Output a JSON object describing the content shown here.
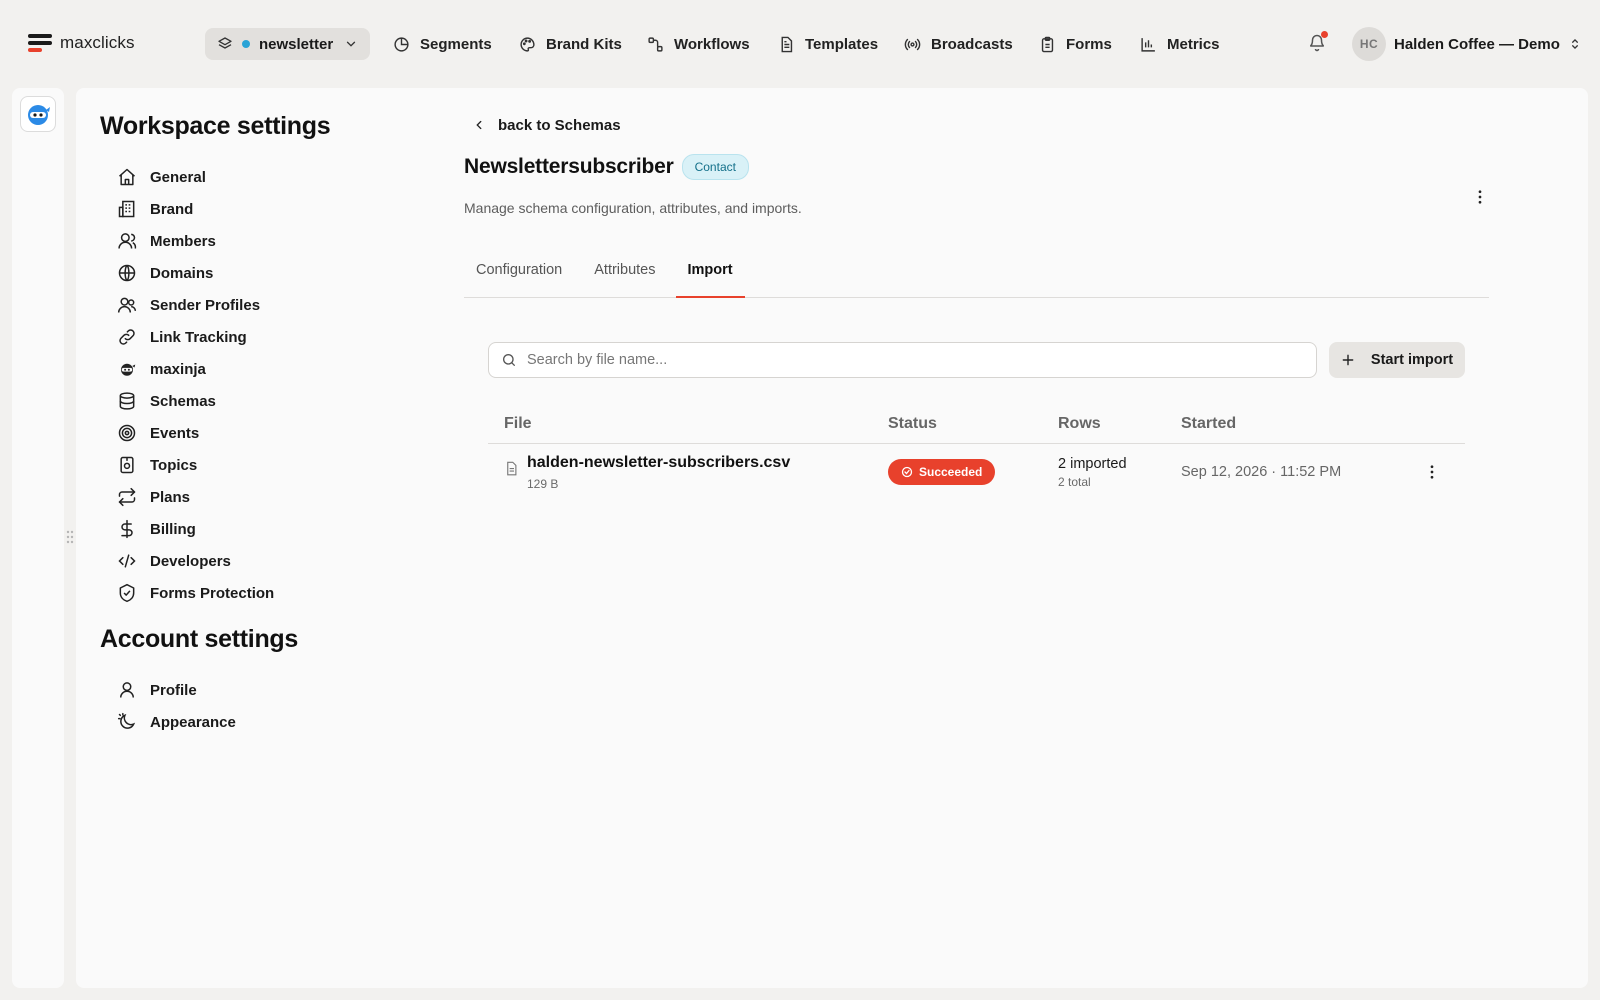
{
  "brand": {
    "name": "maxclicks"
  },
  "workspace": {
    "name": "newsletter"
  },
  "nav": [
    {
      "label": "Segments",
      "icon": "segments-icon"
    },
    {
      "label": "Brand Kits",
      "icon": "palette-icon"
    },
    {
      "label": "Workflows",
      "icon": "workflow-icon"
    },
    {
      "label": "Templates",
      "icon": "document-icon"
    },
    {
      "label": "Broadcasts",
      "icon": "broadcast-icon"
    },
    {
      "label": "Forms",
      "icon": "clipboard-icon"
    },
    {
      "label": "Metrics",
      "icon": "bar-chart-icon"
    }
  ],
  "user": {
    "initials": "HC",
    "name": "Halden Coffee — Demo"
  },
  "settings": {
    "workspace_title": "Workspace settings",
    "workspace_items": [
      {
        "label": "General",
        "icon": "home-icon"
      },
      {
        "label": "Brand",
        "icon": "building-icon"
      },
      {
        "label": "Members",
        "icon": "user-icon"
      },
      {
        "label": "Domains",
        "icon": "globe-icon"
      },
      {
        "label": "Sender Profiles",
        "icon": "users-icon"
      },
      {
        "label": "Link Tracking",
        "icon": "link-icon"
      },
      {
        "label": "maxinja",
        "icon": "ninja-icon"
      },
      {
        "label": "Schemas",
        "icon": "database-icon"
      },
      {
        "label": "Events",
        "icon": "target-icon"
      },
      {
        "label": "Topics",
        "icon": "tag-icon"
      },
      {
        "label": "Plans",
        "icon": "repeat-icon"
      },
      {
        "label": "Billing",
        "icon": "dollar-icon"
      },
      {
        "label": "Developers",
        "icon": "code-icon"
      },
      {
        "label": "Forms Protection",
        "icon": "shield-icon"
      }
    ],
    "account_title": "Account settings",
    "account_items": [
      {
        "label": "Profile",
        "icon": "user-icon"
      },
      {
        "label": "Appearance",
        "icon": "moon-icon"
      }
    ]
  },
  "page": {
    "back_label": "back to Schemas",
    "title": "Newslettersubscriber",
    "badge": "Contact",
    "subtitle": "Manage schema configuration, attributes, and imports.",
    "tabs": [
      {
        "label": "Configuration",
        "active": false
      },
      {
        "label": "Attributes",
        "active": false
      },
      {
        "label": "Import",
        "active": true
      }
    ]
  },
  "imports": {
    "search_placeholder": "Search by file name...",
    "start_label": "Start import",
    "columns": {
      "file": "File",
      "status": "Status",
      "rows": "Rows",
      "started": "Started"
    },
    "rows": [
      {
        "file_name": "halden-newsletter-subscribers.csv",
        "file_size": "129 B",
        "status": "Succeeded",
        "rows_imported": "2 imported",
        "rows_total": "2 total",
        "started": "Sep 12, 2026 · 11:52 PM"
      }
    ]
  },
  "colors": {
    "accent": "#e8412c",
    "badge_bg": "#d9f1f7",
    "workspace_dot": "#29a3d6"
  }
}
